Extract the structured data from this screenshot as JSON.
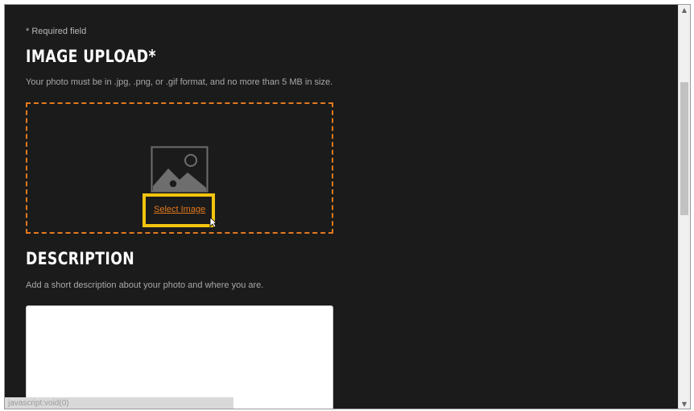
{
  "form": {
    "required_note": "* Required field",
    "image_upload": {
      "heading": "IMAGE UPLOAD*",
      "help_text": "Your photo must be in .jpg, .png, or .gif format, and no more than 5 MB in size.",
      "select_link": "Select Image",
      "icon": "image-placeholder-icon"
    },
    "description": {
      "heading": "DESCRIPTION",
      "help_text": "Add a short description about your photo and where you are.",
      "value": ""
    }
  },
  "statusbar": {
    "text": "javascript:void(0)"
  },
  "colors": {
    "background": "#1b1b1b",
    "accent_orange": "#e2791c",
    "highlight_yellow": "#f2c40f",
    "heading_text": "#ffffff"
  }
}
